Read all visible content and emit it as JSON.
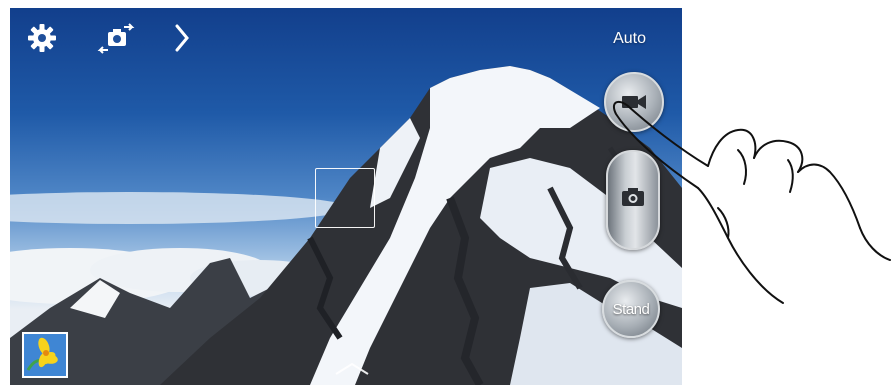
{
  "toolbar": {
    "settings_icon": "gear-icon",
    "switch_camera_icon": "switch-camera-icon",
    "expand_icon": "chevron-right-icon",
    "shooting_mode_label": "Auto"
  },
  "controls": {
    "record_icon": "video-camera-icon",
    "capture_icon": "camera-icon",
    "stand_label": "Stand"
  },
  "gallery": {
    "thumbnail_icon": "flower-thumbnail"
  },
  "colors": {
    "sky_top": "#123f8c",
    "button_silver": "#a9b0b7",
    "overlay_text": "#ffffff"
  }
}
